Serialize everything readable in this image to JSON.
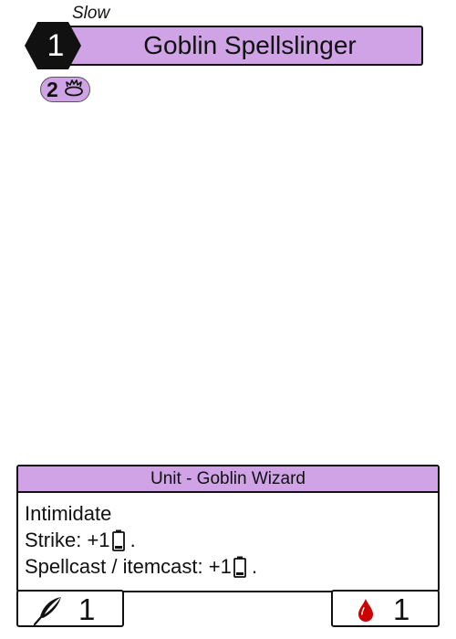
{
  "card": {
    "speed": "Slow",
    "cost": "1",
    "name": "Goblin Spellslinger",
    "secondary_cost": "2",
    "type_line": "Unit - Goblin Wizard",
    "rules": [
      "Intimidate",
      "Strike: +1",
      "Spellcast / itemcast:  +1"
    ],
    "rule_suffix": ".",
    "stats": {
      "power": "1",
      "health": "1"
    }
  },
  "colors": {
    "accent": "#cfa3e6",
    "ink": "#111111",
    "blood": "#cc0000"
  },
  "icons": {
    "cost": "lightning-bolt-icon",
    "secondary": "eye-fire-icon",
    "rules": "battery-icon",
    "power": "quill-icon",
    "health": "blood-drop-icon"
  }
}
